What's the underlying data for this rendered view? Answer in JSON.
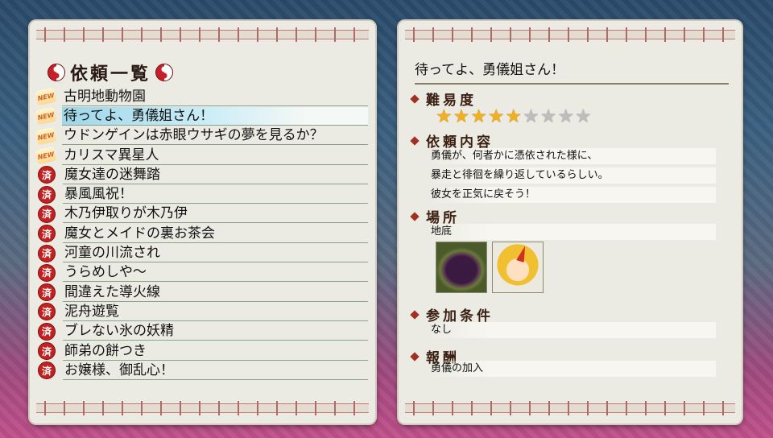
{
  "left_panel": {
    "title": "依頼一覧",
    "items": [
      {
        "status": "new",
        "badge": "NEW",
        "label": "古明地動物園"
      },
      {
        "status": "new",
        "badge": "NEW",
        "label": "待ってよ、勇儀姐さん！",
        "selected": true
      },
      {
        "status": "new",
        "badge": "NEW",
        "label": "ウドンゲインは赤眼ウサギの夢を見るか？"
      },
      {
        "status": "new",
        "badge": "NEW",
        "label": "カリスマ異星人"
      },
      {
        "status": "done",
        "badge": "済",
        "label": "魔女達の迷舞踏"
      },
      {
        "status": "done",
        "badge": "済",
        "label": "暴風風祝！"
      },
      {
        "status": "done",
        "badge": "済",
        "label": "木乃伊取りが木乃伊"
      },
      {
        "status": "done",
        "badge": "済",
        "label": "魔女とメイドの裏お茶会"
      },
      {
        "status": "done",
        "badge": "済",
        "label": "河童の川流され"
      },
      {
        "status": "done",
        "badge": "済",
        "label": "うらめしや〜"
      },
      {
        "status": "done",
        "badge": "済",
        "label": "間違えた導火線"
      },
      {
        "status": "done",
        "badge": "済",
        "label": "泥舟遊覧"
      },
      {
        "status": "done",
        "badge": "済",
        "label": "ブレない氷の妖精"
      },
      {
        "status": "done",
        "badge": "済",
        "label": "師弟の餅つき"
      },
      {
        "status": "done",
        "badge": "済",
        "label": "お嬢様、御乱心！"
      }
    ]
  },
  "detail": {
    "title": "待ってよ、勇儀姐さん！",
    "difficulty_heading": "難易度",
    "difficulty": 5,
    "difficulty_max": 9,
    "content_heading": "依頼内容",
    "content_lines": [
      "勇儀が、何者かに憑依された様に、",
      "暴走と徘徊を繰り返しているらしい。",
      "彼女を正気に戻そう！"
    ],
    "location_heading": "場所",
    "location": "地底",
    "condition_heading": "参加条件",
    "condition": "なし",
    "reward_heading": "報酬",
    "reward": "勇儀の加入"
  },
  "colors": {
    "panel": "#ecebe3",
    "accent_red": "#c42020",
    "star_on": "#f0b020",
    "star_off": "#bdbdbd",
    "selected": "#9fd6ea"
  }
}
